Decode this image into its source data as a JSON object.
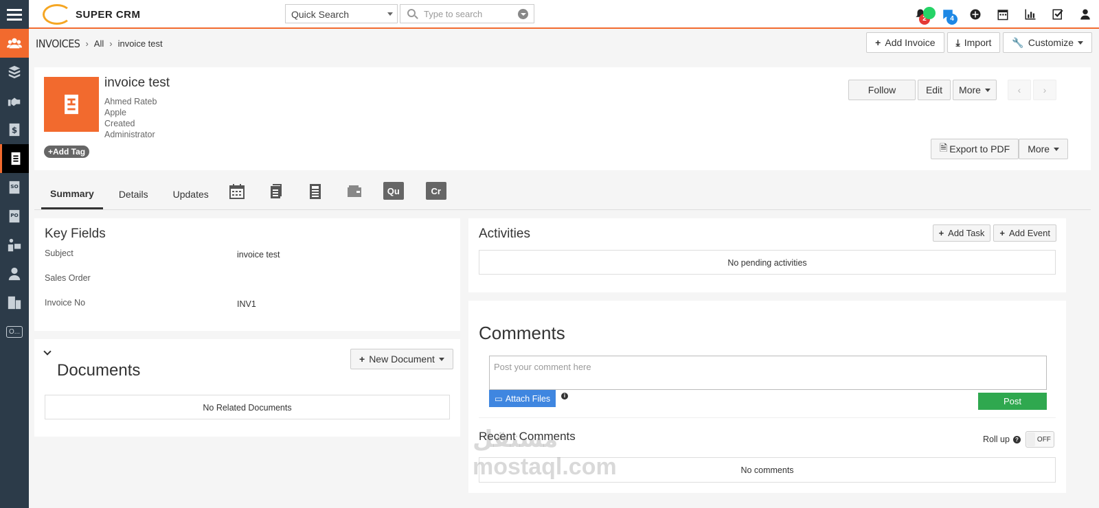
{
  "app": {
    "name": "SUPER CRM",
    "accent": "#f26a2e",
    "sidebar_bg": "#2c3b49"
  },
  "sidebar": {
    "items": [
      {
        "icon": "users-icon"
      },
      {
        "icon": "cubes-icon"
      },
      {
        "icon": "handshake-icon"
      },
      {
        "icon": "dollar-icon"
      },
      {
        "icon": "invoice-icon",
        "active": true
      },
      {
        "icon": "sales-order-icon"
      },
      {
        "icon": "purchase-order-icon"
      },
      {
        "icon": "vendor-icon"
      },
      {
        "icon": "contact-icon"
      },
      {
        "icon": "building-icon"
      },
      {
        "icon": "other-icon",
        "label": "O..."
      }
    ]
  },
  "topbar": {
    "quick_search_label": "Quick Search",
    "search_placeholder": "Type to search",
    "notifications_count": "2",
    "messages_count": "4"
  },
  "breadcrumb": {
    "module": "INVOICES",
    "filter": "All",
    "record": "invoice test"
  },
  "header_actions": {
    "add_invoice": "Add Invoice",
    "import": "Import",
    "customize": "Customize"
  },
  "record": {
    "title": "invoice test",
    "lines": [
      "Ahmed Rateb",
      "Apple",
      "Created",
      "Administrator"
    ],
    "add_tag": "Add Tag",
    "follow": "Follow",
    "edit": "Edit",
    "more": "More",
    "export_pdf": "Export to PDF",
    "more2": "More"
  },
  "tabs": {
    "summary": "Summary",
    "details": "Details",
    "updates": "Updates",
    "icons": [
      "calendar-icon",
      "document-icon",
      "calculator-icon",
      "wallet-icon"
    ],
    "chip_qu": "Qu",
    "chip_cr": "Cr"
  },
  "key_fields": {
    "title": "Key Fields",
    "rows": [
      {
        "label": "Subject",
        "value": "invoice test"
      },
      {
        "label": "Sales Order",
        "value": ""
      },
      {
        "label": "Invoice No",
        "value": "INV1"
      }
    ]
  },
  "documents": {
    "title": "Documents",
    "new_document": "New Document",
    "empty": "No Related Documents"
  },
  "activities": {
    "title": "Activities",
    "add_task": "Add Task",
    "add_event": "Add Event",
    "empty": "No pending activities"
  },
  "comments": {
    "title": "Comments",
    "placeholder": "Post your comment here",
    "attach": "Attach Files",
    "post": "Post",
    "recent_title": "Recent Comments",
    "rollup": "Roll up",
    "toggle": "OFF",
    "empty": "No comments"
  },
  "watermark": {
    "line1": "مستقل",
    "line2": "mostaql.com"
  }
}
